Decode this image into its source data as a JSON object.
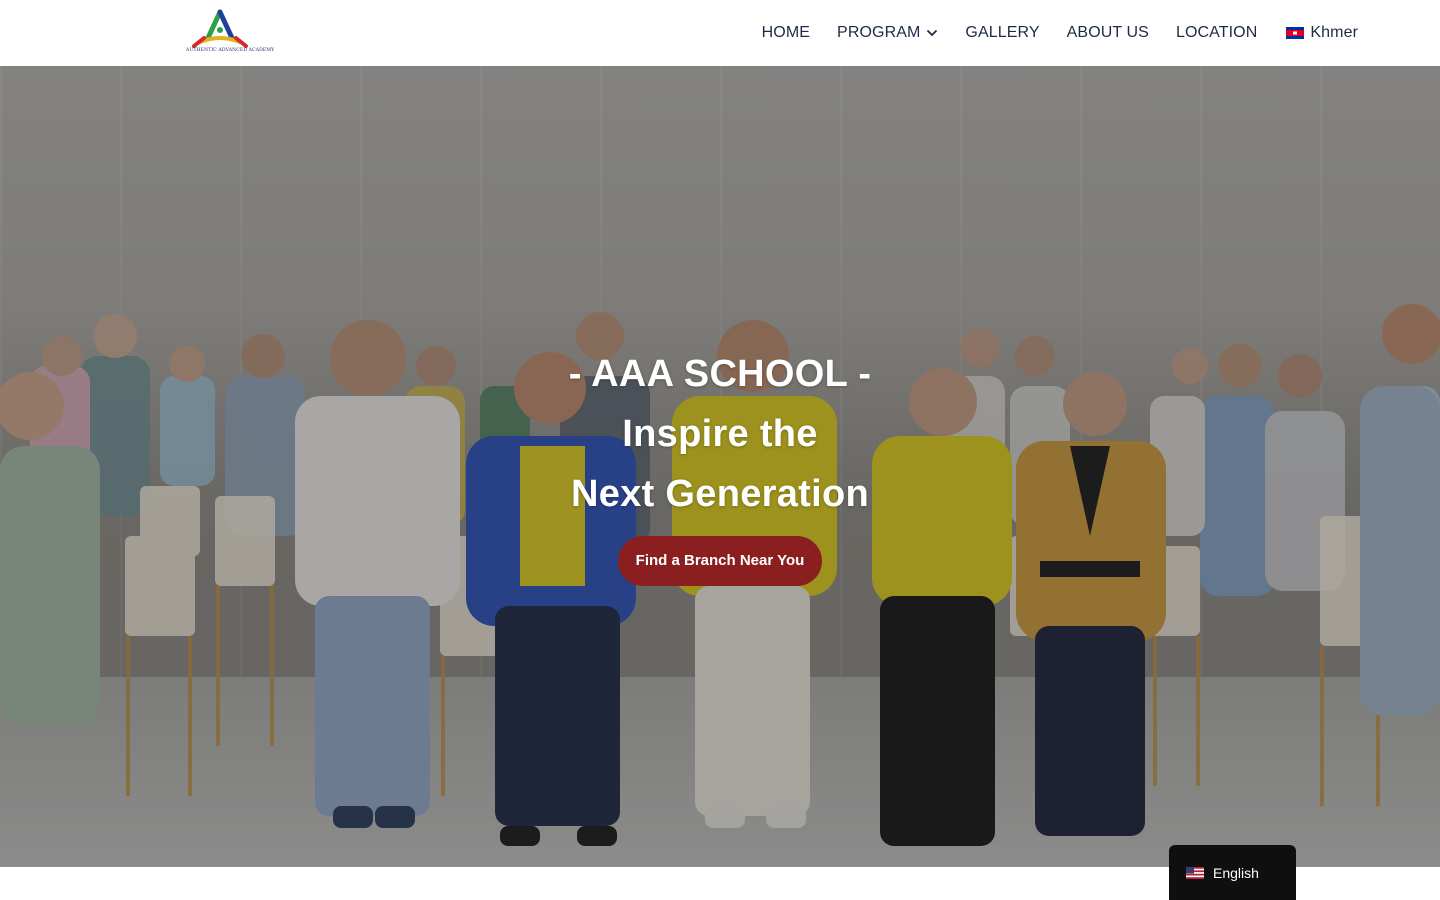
{
  "header": {
    "logo_text": "AUTHENTIC ADVANCED ACADEMY",
    "nav": [
      {
        "label": "HOME"
      },
      {
        "label": "PROGRAM"
      },
      {
        "label": "GALLERY"
      },
      {
        "label": "ABOUT US"
      },
      {
        "label": "LOCATION"
      },
      {
        "label": "Khmer"
      }
    ]
  },
  "hero": {
    "line1": "- AAA SCHOOL -",
    "line2": "Inspire the",
    "line3": "Next Generation",
    "cta_label": "Find a Branch Near You"
  },
  "language_switcher": {
    "label": "English"
  },
  "colors": {
    "nav_text": "#1e2b46",
    "cta_background": "#8b1f1f",
    "switcher_background": "#0f0f10"
  }
}
